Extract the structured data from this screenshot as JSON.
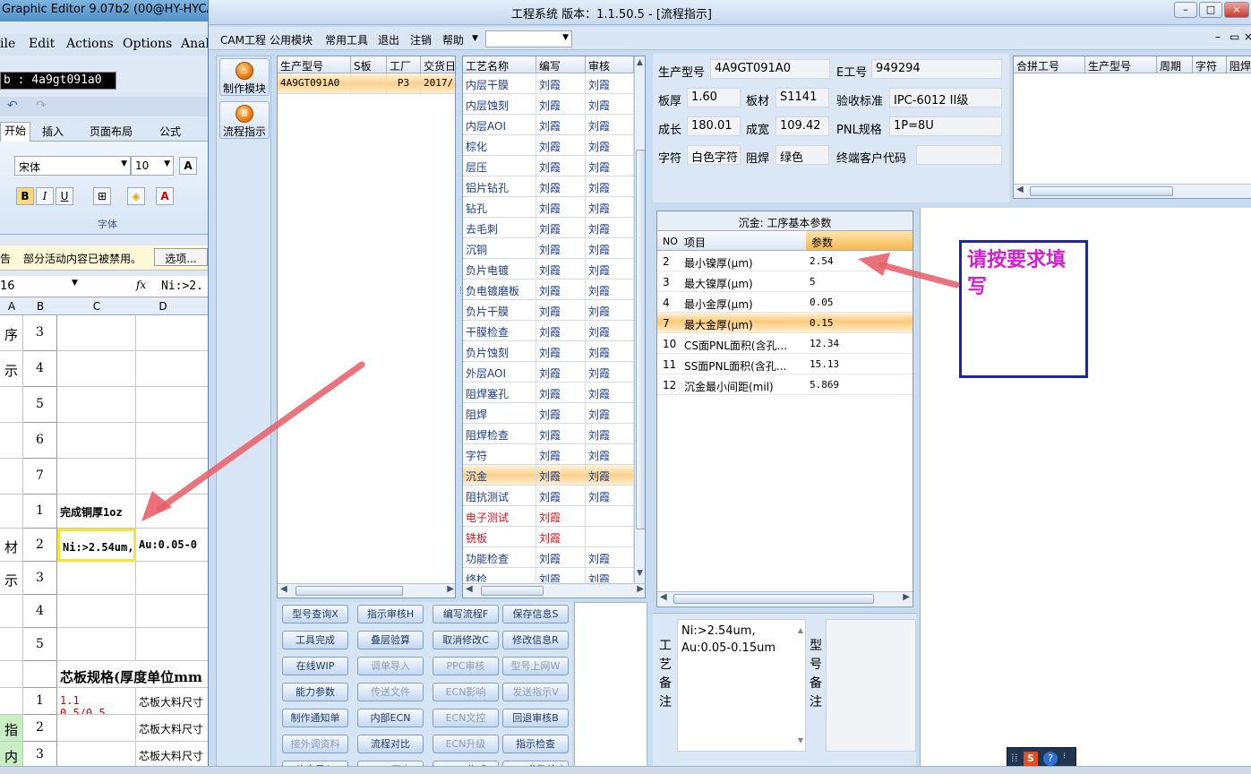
{
  "bg_window": {
    "title": "Graphic Editor 9.07b2 (00@HY-HYCAM-",
    "menu": [
      "ile",
      "Edit",
      "Actions",
      "Options",
      "Anal"
    ],
    "job_label": "b : 4a9gt091a0",
    "ribbon_tabs": [
      "开始",
      "插入",
      "页面布局",
      "公式"
    ],
    "font_name": "宋体",
    "font_size": "10",
    "font_group_label": "字体",
    "warning_prefix": "告",
    "warning_text": "部分活动内容已被禁用。",
    "options_button": "选项...",
    "name_box": "16",
    "fx": "fx",
    "formula": "Ni:>2.",
    "col_headers": [
      "A",
      "B",
      "C",
      "D"
    ],
    "rows": [
      {
        "num": "3",
        "text": "",
        "tag": "序"
      },
      {
        "num": "4",
        "text": "",
        "tag": "示"
      },
      {
        "num": "5",
        "text": "",
        "tag": ""
      },
      {
        "num": "6",
        "text": "",
        "tag": ""
      },
      {
        "num": "7",
        "text": "",
        "tag": ""
      },
      {
        "num": "1",
        "text": "完成铜厚1oz",
        "tag": ""
      },
      {
        "num": "2",
        "text": "Ni:>2.54um,",
        "extra": "Au:0.05-0",
        "tag": "材"
      },
      {
        "num": "3",
        "text": "",
        "tag": "示"
      },
      {
        "num": "4",
        "text": "",
        "tag": ""
      },
      {
        "num": "5",
        "text": "",
        "tag": ""
      },
      {
        "num": "",
        "text": "芯板规格(厚度单位mm",
        "tag": ""
      },
      {
        "num": "1",
        "text": "1.1",
        "extra": "芯板大料尺寸",
        "sub": "0.5/0.5",
        "tag": ""
      },
      {
        "num": "2",
        "text": "",
        "extra": "芯板大料尺寸",
        "tag": "指文"
      },
      {
        "num": "3",
        "text": "",
        "extra": "芯板大料尺寸",
        "tag": "内容"
      }
    ]
  },
  "app": {
    "title": "工程系统    版本：1.1.50.5 - [流程指示]",
    "window_buttons": [
      "–",
      "□",
      "×"
    ],
    "mdi_buttons": [
      "–",
      "▭",
      "×"
    ],
    "menu": [
      "CAM工程",
      "公用模块",
      "常用工具",
      "退出",
      "注销",
      "帮助"
    ],
    "menu_combo": "",
    "tools": [
      {
        "label": "制作模块",
        "icon": "fire-icon"
      },
      {
        "label": "流程指示",
        "icon": "flow-icon"
      }
    ]
  },
  "product_list": {
    "headers": [
      "生产型号",
      "S板",
      "工厂",
      "交货日"
    ],
    "rows": [
      [
        "4A9GT091A0",
        "",
        "P3",
        "2017/"
      ]
    ]
  },
  "process_list": {
    "headers": [
      "工艺名称",
      "编写",
      "审核"
    ],
    "rows": [
      {
        "name": "内层干膜",
        "writer": "刘霞",
        "reviewer": "刘霞",
        "color": "#1a3c8a"
      },
      {
        "name": "内层蚀刻",
        "writer": "刘霞",
        "reviewer": "刘霞",
        "color": "#1a3c8a"
      },
      {
        "name": "内层AOI",
        "writer": "刘霞",
        "reviewer": "刘霞",
        "color": "#1a3c8a"
      },
      {
        "name": "棕化",
        "writer": "刘霞",
        "reviewer": "刘霞",
        "color": "#1a3c8a"
      },
      {
        "name": "层压",
        "writer": "刘霞",
        "reviewer": "刘霞",
        "color": "#1a3c8a"
      },
      {
        "name": "铝片钻孔",
        "writer": "刘霞",
        "reviewer": "刘霞",
        "color": "#1a3c8a"
      },
      {
        "name": "钻孔",
        "writer": "刘霞",
        "reviewer": "刘霞",
        "color": "#1a3c8a"
      },
      {
        "name": "去毛刺",
        "writer": "刘霞",
        "reviewer": "刘霞",
        "color": "#1a3c8a"
      },
      {
        "name": "沉铜",
        "writer": "刘霞",
        "reviewer": "刘霞",
        "color": "#1a3c8a"
      },
      {
        "name": "负片电镀",
        "writer": "刘霞",
        "reviewer": "刘霞",
        "color": "#1a3c8a"
      },
      {
        "name": "负电镀磨板",
        "writer": "刘霞",
        "reviewer": "刘霞",
        "color": "#1a3c8a"
      },
      {
        "name": "负片干膜",
        "writer": "刘霞",
        "reviewer": "刘霞",
        "color": "#1a3c8a"
      },
      {
        "name": "干膜检查",
        "writer": "刘霞",
        "reviewer": "刘霞",
        "color": "#1a3c8a"
      },
      {
        "name": "负片蚀刻",
        "writer": "刘霞",
        "reviewer": "刘霞",
        "color": "#1a3c8a"
      },
      {
        "name": "外层AOI",
        "writer": "刘霞",
        "reviewer": "刘霞",
        "color": "#1a3c8a"
      },
      {
        "name": "阻焊塞孔",
        "writer": "刘霞",
        "reviewer": "刘霞",
        "color": "#1a3c8a"
      },
      {
        "name": "阻焊",
        "writer": "刘霞",
        "reviewer": "刘霞",
        "color": "#1a3c8a"
      },
      {
        "name": "阻焊检查",
        "writer": "刘霞",
        "reviewer": "刘霞",
        "color": "#1a3c8a"
      },
      {
        "name": "字符",
        "writer": "刘霞",
        "reviewer": "刘霞",
        "color": "#1a3c8a"
      },
      {
        "name": "沉金",
        "writer": "刘霞",
        "reviewer": "刘霞",
        "color": "#1a3c8a",
        "selected": true
      },
      {
        "name": "阻抗测试",
        "writer": "刘霞",
        "reviewer": "刘霞",
        "color": "#1a3c8a"
      },
      {
        "name": "电子测试",
        "writer": "刘霞",
        "reviewer": "",
        "color": "#d0161b"
      },
      {
        "name": "铣板",
        "writer": "刘霞",
        "reviewer": "",
        "color": "#d0161b"
      },
      {
        "name": "功能检查",
        "writer": "刘霞",
        "reviewer": "刘霞",
        "color": "#1a3c8a"
      },
      {
        "name": "终检",
        "writer": "刘霞",
        "reviewer": "刘霞",
        "color": "#1a3c8a"
      }
    ]
  },
  "buttons": [
    {
      "label": "型号查询X",
      "enabled": true
    },
    {
      "label": "指示审核H",
      "enabled": true
    },
    {
      "label": "编写流程F",
      "enabled": true
    },
    {
      "label": "保存信息S",
      "enabled": true
    },
    {
      "label": "工具完成",
      "enabled": true
    },
    {
      "label": "叠层验算",
      "enabled": true
    },
    {
      "label": "取消修改C",
      "enabled": true
    },
    {
      "label": "修改信息R",
      "enabled": true
    },
    {
      "label": "在线WIP",
      "enabled": true
    },
    {
      "label": "调单导入",
      "enabled": false
    },
    {
      "label": "PPC审核",
      "enabled": false
    },
    {
      "label": "型号上网W",
      "enabled": false
    },
    {
      "label": "能力参数",
      "enabled": true
    },
    {
      "label": "传送文件",
      "enabled": false
    },
    {
      "label": "ECN影响",
      "enabled": false
    },
    {
      "label": "发送指示V",
      "enabled": false
    },
    {
      "label": "制作通知单",
      "enabled": true
    },
    {
      "label": "内部ECN",
      "enabled": true
    },
    {
      "label": "ECN文控",
      "enabled": false
    },
    {
      "label": "回退审核B",
      "enabled": true
    },
    {
      "label": "接外调资料",
      "enabled": false
    },
    {
      "label": "流程对比",
      "enabled": true
    },
    {
      "label": "ECN升级",
      "enabled": false
    },
    {
      "label": "指示检查",
      "enabled": true
    },
    {
      "label": "信息导入",
      "enabled": true
    },
    {
      "label": "MES同步",
      "enabled": false
    },
    {
      "label": "BOM生成",
      "enabled": true
    },
    {
      "label": "BOM参数检查",
      "enabled": true
    }
  ],
  "info": {
    "model_label": "生产型号",
    "model": "4A9GT091A0",
    "e_label": "E工号",
    "e_no": "949294",
    "thick_label": "板厚",
    "thick": "1.60",
    "material_label": "板材",
    "material": "S1141",
    "std_label": "验收标准",
    "std": "IPC-6012 II级",
    "len_label": "成长",
    "len": "180.01",
    "width_label": "成宽",
    "width": "109.42",
    "pnl_label": "PNL规格",
    "pnl": "1P=8U",
    "char_label": "字符",
    "char": "白色字符",
    "mask_label": "阻焊",
    "mask": "绿色",
    "cust_label": "终端客户代码",
    "cust": ""
  },
  "merge_table": {
    "headers": [
      "合拼工号",
      "生产型号",
      "周期",
      "字符",
      "阻焊"
    ]
  },
  "params": {
    "title": "沉金: 工序基本参数",
    "headers": [
      "NO",
      "项目",
      "参数"
    ],
    "rows": [
      {
        "no": "2",
        "item": "最小镍厚(μm)",
        "value": "2.54"
      },
      {
        "no": "3",
        "item": "最大镍厚(μm)",
        "value": "5"
      },
      {
        "no": "4",
        "item": "最小金厚(μm)",
        "value": "0.05"
      },
      {
        "no": "7",
        "item": "最大金厚(μm)",
        "value": "0.15",
        "selected": true
      },
      {
        "no": "10",
        "item": "CS面PNL面积(含孔...",
        "value": "12.34"
      },
      {
        "no": "11",
        "item": "SS面PNL面积(含孔...",
        "value": "15.13"
      },
      {
        "no": "12",
        "item": "沉金最小间距(mil)",
        "value": "5.869"
      }
    ]
  },
  "annotation": "请按要求填写",
  "remarks": {
    "process_label": [
      "工",
      "艺",
      "备",
      "注"
    ],
    "process_text_1": "Ni:>2.54um,",
    "process_text_2": "Au:0.05-0.15um",
    "model_label": [
      "型",
      "号",
      "备",
      "注"
    ]
  },
  "tray_icons": [
    "keyboard-icon",
    "sogou-icon",
    "help-icon"
  ]
}
